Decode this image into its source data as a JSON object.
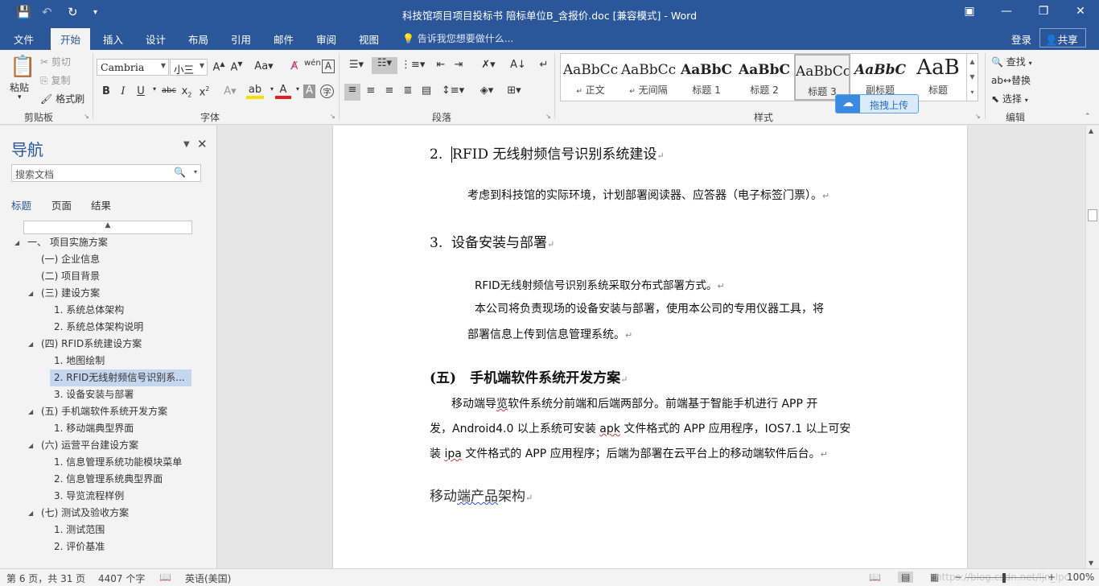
{
  "window": {
    "title": "科技馆项目项目投标书 陪标单位B_含报价.doc [兼容模式] - Word"
  },
  "tabs": [
    "文件",
    "开始",
    "插入",
    "设计",
    "布局",
    "引用",
    "邮件",
    "审阅",
    "视图"
  ],
  "tell_me": "告诉我您想要做什么...",
  "account": {
    "login": "登录",
    "share": "共享"
  },
  "ribbon": {
    "clipboard": {
      "paste": "粘贴",
      "cut": "剪切",
      "copy": "复制",
      "format_painter": "格式刷",
      "label": "剪贴板"
    },
    "font": {
      "name": "Cambria",
      "size": "小三",
      "label": "字体"
    },
    "paragraph": {
      "label": "段落"
    },
    "styles": {
      "label": "样式",
      "items": [
        {
          "sample": "AaBbCc",
          "name": "正文"
        },
        {
          "sample": "AaBbCc",
          "name": "无间隔"
        },
        {
          "sample": "AaBbC",
          "name": "标题 1"
        },
        {
          "sample": "AaBbC",
          "name": "标题 2"
        },
        {
          "sample": "AaBbCc",
          "name": "标题 3"
        },
        {
          "sample": "AaBbC",
          "name": "副标题"
        },
        {
          "sample": "AaB",
          "name": "标题"
        }
      ]
    },
    "editing": {
      "find": "查找",
      "replace": "替换",
      "select": "选择",
      "label": "编辑"
    },
    "upload": "拖拽上传"
  },
  "nav": {
    "title": "导航",
    "search_placeholder": "搜索文档",
    "tabs": [
      "标题",
      "页面",
      "结果"
    ],
    "items": [
      {
        "label": "一、 项目实施方案",
        "level": 0,
        "expanded": true
      },
      {
        "label": "(一) 企业信息",
        "level": 1
      },
      {
        "label": "(二) 项目背景",
        "level": 1
      },
      {
        "label": "(三) 建设方案",
        "level": 1,
        "expanded": true
      },
      {
        "label": "1. 系统总体架构",
        "level": 2
      },
      {
        "label": "2. 系统总体架构说明",
        "level": 2
      },
      {
        "label": "(四) RFID系统建设方案",
        "level": 1,
        "expanded": true
      },
      {
        "label": "1. 地图绘制",
        "level": 2
      },
      {
        "label": "2. RFID无线射频信号识别系...",
        "level": 2,
        "selected": true
      },
      {
        "label": "3. 设备安装与部署",
        "level": 2
      },
      {
        "label": "(五) 手机端软件系统开发方案",
        "level": 1,
        "expanded": true
      },
      {
        "label": "1. 移动端典型界面",
        "level": 2
      },
      {
        "label": "(六) 运营平台建设方案",
        "level": 1,
        "expanded": true
      },
      {
        "label": "1. 信息管理系统功能模块菜单",
        "level": 2
      },
      {
        "label": "2. 信息管理系统典型界面",
        "level": 2
      },
      {
        "label": "3. 导览流程样例",
        "level": 2
      },
      {
        "label": "(七) 测试及验收方案",
        "level": 1,
        "expanded": true
      },
      {
        "label": "1. 测试范围",
        "level": 2
      },
      {
        "label": "2. 评价基准",
        "level": 2
      }
    ]
  },
  "document": {
    "h_rfid_num": "2.",
    "h_rfid": "RFID 无线射频信号识别系统建设",
    "p_rfid": "考虑到科技馆的实际环境，计划部署阅读器、应答器（电子标签门票）。",
    "h_install_num": "3.",
    "h_install": "设备安装与部署",
    "p_install1": "RFID无线射频信号识别系统采取分布式部署方式。",
    "p_install2a": "本公司将负责现场的设备安装与部署，使用本公司的专用仪器工具，将",
    "p_install2b": "部署信息上传到信息管理系统。",
    "h_mobile": "(五)　手机端软件系统开发方案",
    "p_mobile1a": "移动端导",
    "p_mobile1b": "览",
    "p_mobile1c": "软件系统分前端和后端两部分。前端基于智能手机进行 APP 开",
    "p_mobile2a": "发，Android4.0 以上系统可安装 ",
    "p_mobile2b": "apk",
    "p_mobile2c": " 文件格式的 APP 应用程序，IOS7.1 以上可安",
    "p_mobile3a": "装 ",
    "p_mobile3b": "ipa",
    "p_mobile3c": " 文件格式的 APP 应用程序；后端为部署在云平台上的移动端软件后台。",
    "h_arch_a": "移动",
    "h_arch_b": "端产品",
    "h_arch_c": "架构"
  },
  "status": {
    "page": "第 6 页，共 31 页",
    "words": "4407 个字",
    "language": "英语(美国)",
    "zoom": "100%",
    "watermark": "https://blog.csdn.net/ljn_lpc"
  }
}
